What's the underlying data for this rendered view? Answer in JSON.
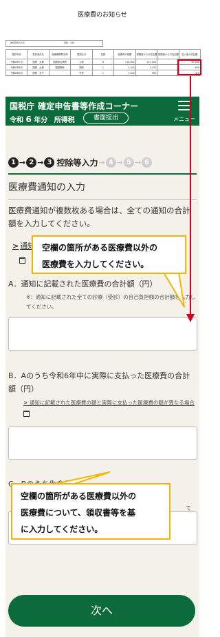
{
  "notice": {
    "title": "医療費のお知らせ",
    "patient_label": "被保険者の氏名",
    "patient_name": "国税　太郎",
    "headers": [
      "受診年月",
      "受診者氏名",
      "医療機関等名称",
      "受診区分",
      "日数",
      "医療費の総額",
      "保険者からの支払額",
      "保険者からの支払額",
      "加入者が支払額"
    ],
    "rows": [
      {
        "date": "令和6年7月",
        "name": "国税　太郎",
        "facility": "国税総合病院",
        "type": "入院",
        "days": "8",
        "total": "210,000",
        "insurer": "147,000",
        "insurer2": "",
        "paid": "63,000"
      },
      {
        "date": "令和6年8月",
        "name": "国税　太郎",
        "facility": "国税薬局",
        "type": "調剤",
        "days": "1",
        "total": "2,100",
        "insurer": "1,470",
        "insurer2": "",
        "paid": "630"
      },
      {
        "date": "令和6年9月",
        "name": "国税　花子",
        "facility": "",
        "type": "外来",
        "days": "1",
        "total": "1,400",
        "insurer": "980",
        "insurer2": "",
        "paid": "420"
      }
    ],
    "highlight_color": "#d0001e"
  },
  "header": {
    "title": "国税庁 確定申告書等作成コーナー",
    "year_prefix": "令和",
    "year": "6",
    "year_suffix": "年分",
    "tax_type": "所得税",
    "submit_button": "書面提出",
    "menu_label": "メニュー",
    "color": "#0c6b3a"
  },
  "steps": {
    "items": [
      "1",
      "2",
      "3",
      "4",
      "5",
      "6"
    ],
    "current": 3,
    "current_label": "控除等入力"
  },
  "page_title": "医療費通知の入力",
  "intro": "医療費通知が複数枚ある場合は、全ての通知の合計額を入力してください。",
  "link1": "通知",
  "question_a": {
    "label": "A．通知に記載された医療費の合計額（円）",
    "note": "※：通知に記載された全ての診療（受診）の自己負担額の合計額を入力してください。",
    "value": ""
  },
  "question_b": {
    "label": "B．Aのうち令和6年中に実際に支払った医療費の合計額（円）",
    "link": "通知に記載された医療費の額と実際に支払った医療費の額が異なる場合",
    "value": ""
  },
  "question_c": {
    "label": "C．Bのうち生命保険",
    "tail": "て",
    "value": ""
  },
  "next_button": "次へ",
  "callouts": {
    "top": [
      "空欄の箇所がある医療費以外の",
      "医療費を入力してください。"
    ],
    "bottom": [
      "空欄の箇所がある医療費以外の",
      "医療費について、領収書等を基",
      "に入力してください。"
    ],
    "border_color": "#f5b400"
  }
}
